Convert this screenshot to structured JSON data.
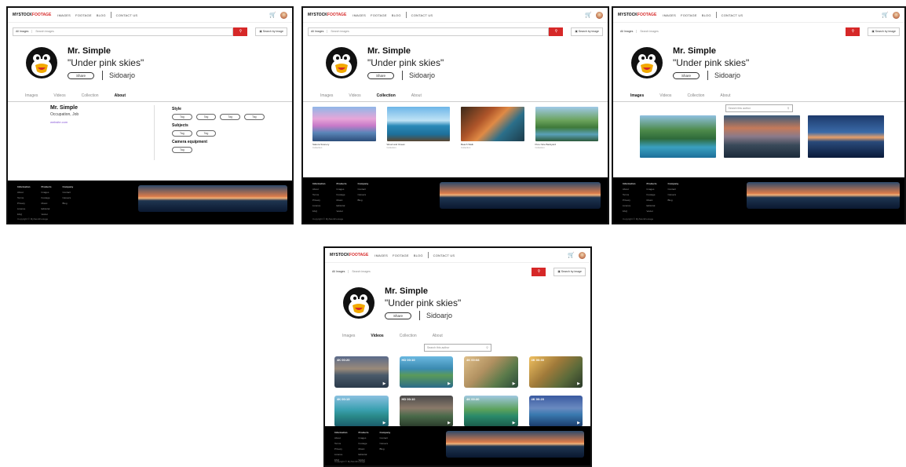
{
  "nav": {
    "logo_a": "MYSTOCK",
    "logo_b": "FOOTAGE",
    "links": [
      "IMAGES",
      "FOOTAGE",
      "BLOG"
    ],
    "contact": "CONTACT US"
  },
  "search": {
    "category": "All Images",
    "placeholder": "Search images",
    "image_search": "Search by image"
  },
  "profile": {
    "name": "Mr. Simple",
    "quote": "\"Under pink skies\"",
    "share_label": "Share",
    "location": "Sidoarjo"
  },
  "tabs": [
    "Images",
    "Videos",
    "Collection",
    "About"
  ],
  "about": {
    "name": "Mr. Simple",
    "occupation": "Occupation, Job",
    "website": "website.com",
    "style_title": "Style",
    "style_tags": [
      "Tag",
      "Tag",
      "Tag",
      "Tag"
    ],
    "subjects_title": "Subjects",
    "subjects_tags": [
      "Tag",
      "Tag"
    ],
    "camera_title": "Camera equipment",
    "camera_tags": [
      "Tag"
    ]
  },
  "collections": [
    {
      "title": "Sakura Scenery",
      "sub": "Collection"
    },
    {
      "title": "Wood and Ocean",
      "sub": "Collection"
    },
    {
      "title": "Beach Walk",
      "sub": "Collection"
    },
    {
      "title": "Pure Nice Backyard",
      "sub": "Collection"
    }
  ],
  "search_author_placeholder": "Search this author",
  "videos": [
    {
      "badge": "4K 00:20"
    },
    {
      "badge": "HD 00:10"
    },
    {
      "badge": "4K 00:08"
    },
    {
      "badge": "4K 00:30"
    },
    {
      "badge": "4K 00:15"
    },
    {
      "badge": "HD 00:10"
    },
    {
      "badge": "4K 00:30"
    },
    {
      "badge": "4K 00:20"
    }
  ],
  "footer": {
    "col1": [
      "Information",
      "About",
      "Terms",
      "Privacy",
      "Licence",
      "FAQ"
    ],
    "col2": [
      "Products",
      "Images",
      "Footage",
      "Music",
      "Editorial",
      "Vector"
    ],
    "col3": [
      "Company",
      "Contact",
      "Careers",
      "Blog"
    ],
    "copyright": "Copyright © MyStockFootage"
  }
}
